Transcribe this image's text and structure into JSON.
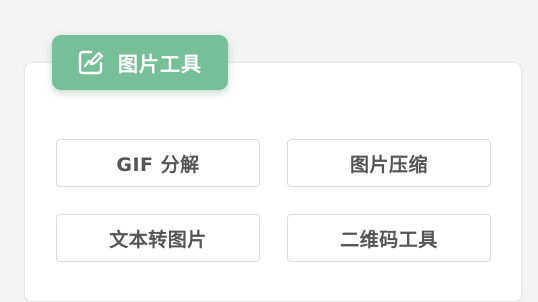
{
  "panel": {
    "title": "图片工具",
    "icon": "image-edit-icon",
    "accent_color": "#77bf98"
  },
  "tools": [
    {
      "label": "GIF 分解"
    },
    {
      "label": "图片压缩"
    },
    {
      "label": "文本转图片"
    },
    {
      "label": "二维码工具"
    }
  ]
}
